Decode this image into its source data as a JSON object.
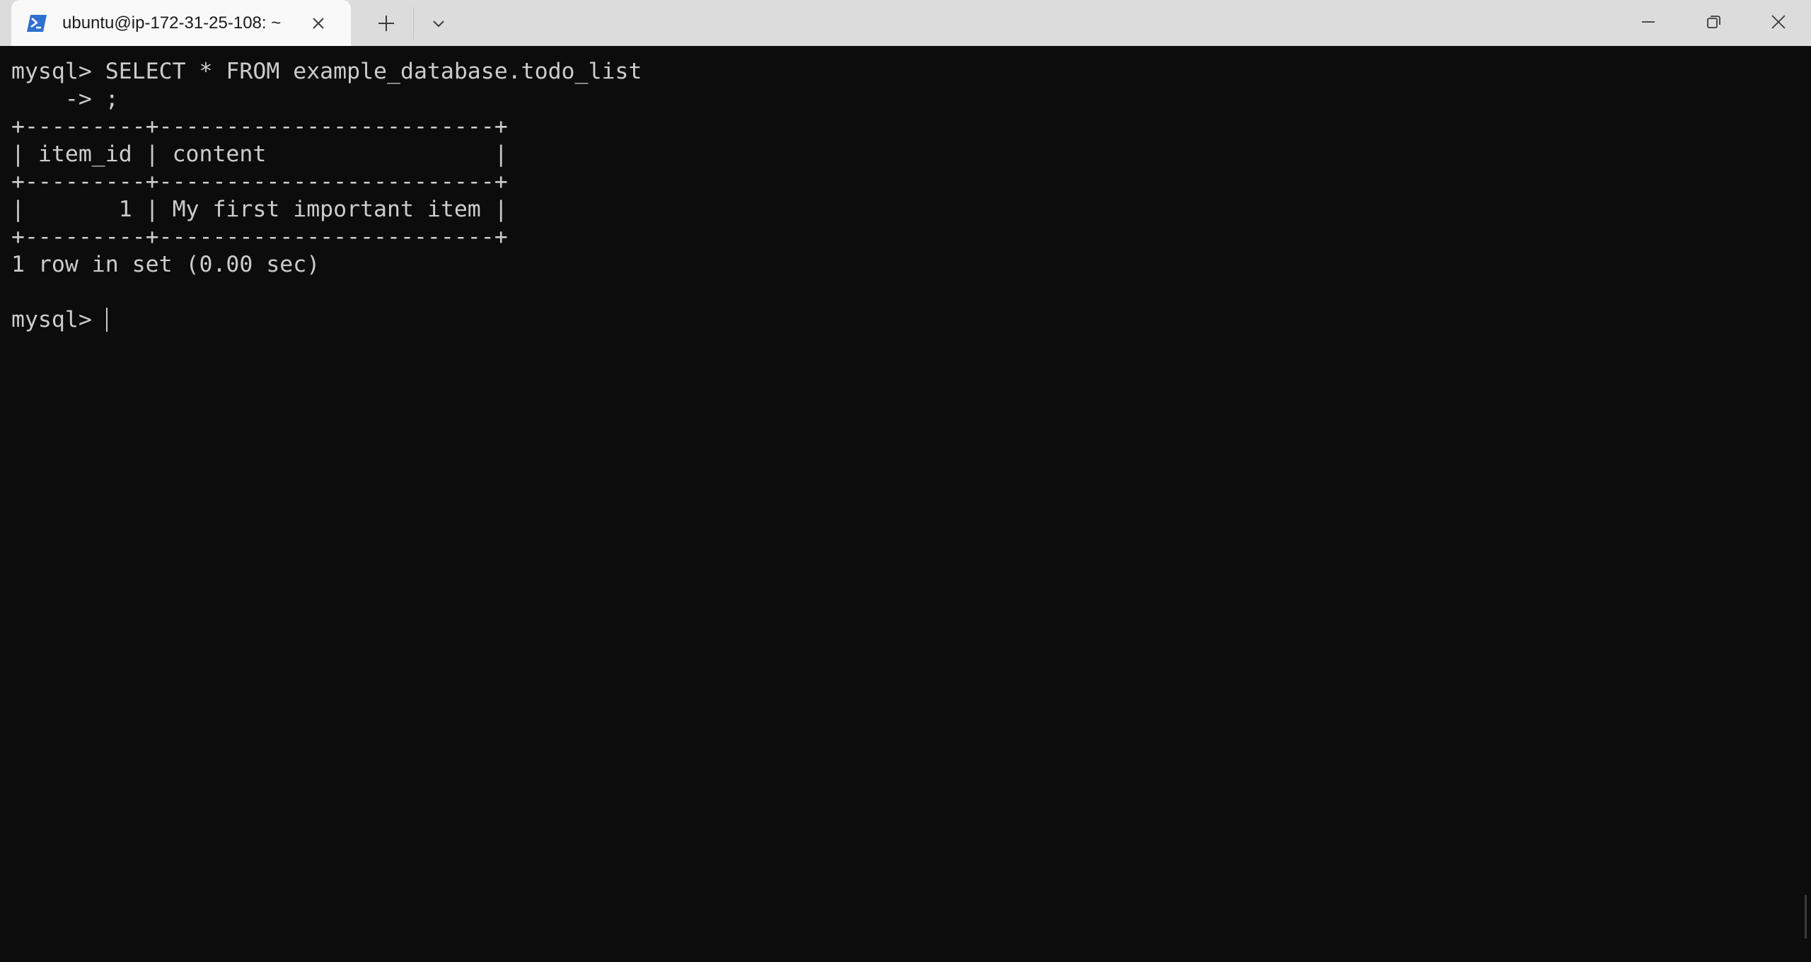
{
  "tab": {
    "title": "ubuntu@ip-172-31-25-108: ~",
    "icon": "powershell-icon"
  },
  "titlebar": {
    "new_tab_icon": "plus-icon",
    "dropdown_icon": "chevron-down-icon",
    "minimize_icon": "minimize-icon",
    "restore_icon": "restore-icon",
    "close_icon": "close-icon"
  },
  "terminal": {
    "lines": [
      "mysql> SELECT * FROM example_database.todo_list",
      "    -> ;",
      "+---------+-------------------------+",
      "| item_id | content                 |",
      "+---------+-------------------------+",
      "|       1 | My first important item |",
      "+---------+-------------------------+",
      "1 row in set (0.00 sec)",
      "",
      "mysql> "
    ],
    "colors": {
      "background": "#0c0c0c",
      "foreground": "#cccccc"
    }
  }
}
